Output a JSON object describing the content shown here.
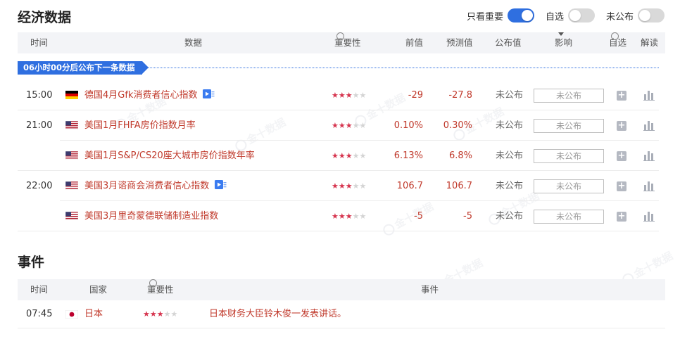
{
  "header": {
    "title": "经济数据",
    "toggles": [
      {
        "label": "只看重要",
        "on": true
      },
      {
        "label": "自选",
        "on": false
      },
      {
        "label": "未公布",
        "on": false
      }
    ]
  },
  "table": {
    "columns": {
      "time": "时间",
      "data": "数据",
      "importance": "重要性",
      "previous": "前值",
      "forecast": "预测值",
      "published": "公布值",
      "impact": "影响",
      "watch": "自选",
      "interpret": "解读"
    },
    "info_glyph": "i",
    "countdown_banner": "06小时00分后公布下一条数据",
    "rows": [
      {
        "time": "15:00",
        "flag": "germany-flag",
        "name": "德国4月Gfk消费者信心指数",
        "has_badge": true,
        "stars": 3,
        "previous": "-29",
        "forecast": "-27.8",
        "published": "未公布",
        "impact": "未公布"
      },
      {
        "time": "21:00",
        "flag": "usa-flag",
        "name": "美国1月FHFA房价指数月率",
        "has_badge": false,
        "stars": 3,
        "previous": "0.10%",
        "forecast": "0.30%",
        "published": "未公布",
        "impact": "未公布"
      },
      {
        "time": "",
        "flag": "usa-flag",
        "name": "美国1月S&P/CS20座大城市房价指数年率",
        "has_badge": false,
        "stars": 3,
        "previous": "6.13%",
        "forecast": "6.8%",
        "published": "未公布",
        "impact": "未公布"
      },
      {
        "time": "22:00",
        "flag": "usa-flag",
        "name": "美国3月谘商会消费者信心指数",
        "has_badge": true,
        "stars": 3,
        "previous": "106.7",
        "forecast": "106.7",
        "published": "未公布",
        "impact": "未公布"
      },
      {
        "time": "",
        "flag": "usa-flag",
        "name": "美国3月里奇蒙德联储制造业指数",
        "has_badge": false,
        "stars": 3,
        "previous": "-5",
        "forecast": "-5",
        "published": "未公布",
        "impact": "未公布"
      }
    ]
  },
  "events": {
    "title": "事件",
    "columns": {
      "time": "时间",
      "country": "国家",
      "importance": "重要性",
      "event": "事件"
    },
    "rows": [
      {
        "time": "07:45",
        "flag": "japan-flag",
        "country": "日本",
        "stars": 3,
        "event": "日本财务大臣铃木俊一发表讲话。"
      }
    ]
  },
  "watermark": "金十数据",
  "colors": {
    "accent": "#2f6fe0",
    "red_text": "#c0392b",
    "star_on": "#d6344e",
    "star_off": "#d4d4d4"
  }
}
